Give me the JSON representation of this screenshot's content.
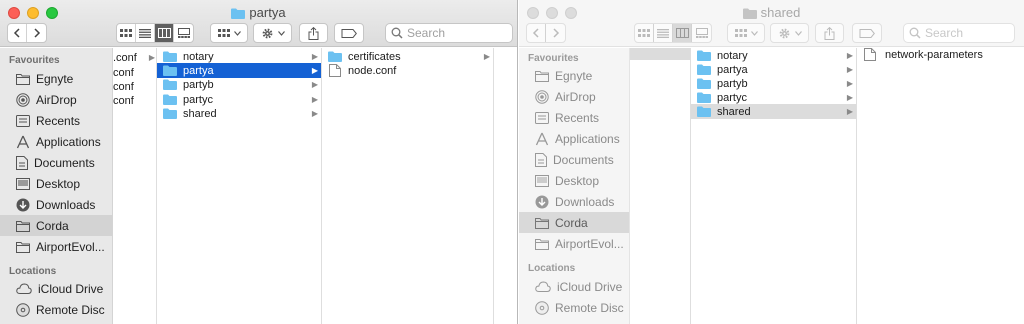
{
  "colors": {
    "close": "#fc5f57",
    "minimize": "#fdbc2e",
    "zoom": "#28c840",
    "inactive_light": "#dcdcdc",
    "selection": "#1461d4",
    "folder": "#6cc1f1"
  },
  "window1": {
    "title": "partya",
    "search_placeholder": "Search",
    "sidebar": {
      "favourites_heading": "Favourites",
      "favourites": [
        {
          "label": "Egnyte",
          "icon": "folder-icon"
        },
        {
          "label": "AirDrop",
          "icon": "airdrop-icon"
        },
        {
          "label": "Recents",
          "icon": "recents-icon"
        },
        {
          "label": "Applications",
          "icon": "applications-icon"
        },
        {
          "label": "Documents",
          "icon": "documents-icon"
        },
        {
          "label": "Desktop",
          "icon": "desktop-icon"
        },
        {
          "label": "Downloads",
          "icon": "downloads-icon"
        },
        {
          "label": "Corda",
          "icon": "folder-icon"
        },
        {
          "label": "AirportEvol...",
          "icon": "folder-icon"
        }
      ],
      "locations_heading": "Locations",
      "locations": [
        {
          "label": "iCloud Drive",
          "icon": "cloud-icon"
        },
        {
          "label": "Remote Disc",
          "icon": "disc-icon"
        }
      ]
    },
    "partial_column": [
      ".conf",
      "conf",
      "conf",
      "conf"
    ],
    "column1": [
      "notary",
      "partya",
      "partyb",
      "partyc",
      "shared"
    ],
    "column1_selected": "partya",
    "column2": [
      {
        "label": "certificates",
        "type": "folder"
      },
      {
        "label": "node.conf",
        "type": "file"
      }
    ]
  },
  "window2": {
    "title": "shared",
    "search_placeholder": "Search",
    "sidebar": {
      "favourites_heading": "Favourites",
      "favourites": [
        {
          "label": "Egnyte",
          "icon": "folder-icon"
        },
        {
          "label": "AirDrop",
          "icon": "airdrop-icon"
        },
        {
          "label": "Recents",
          "icon": "recents-icon"
        },
        {
          "label": "Applications",
          "icon": "applications-icon"
        },
        {
          "label": "Documents",
          "icon": "documents-icon"
        },
        {
          "label": "Desktop",
          "icon": "desktop-icon"
        },
        {
          "label": "Downloads",
          "icon": "downloads-icon"
        },
        {
          "label": "Corda",
          "icon": "folder-icon"
        },
        {
          "label": "AirportEvol...",
          "icon": "folder-icon"
        }
      ],
      "locations_heading": "Locations",
      "locations": [
        {
          "label": "iCloud Drive",
          "icon": "cloud-icon"
        },
        {
          "label": "Remote Disc",
          "icon": "disc-icon"
        }
      ]
    },
    "column1": [
      "notary",
      "partya",
      "partyb",
      "partyc",
      "shared"
    ],
    "column1_selected": "shared",
    "column2": [
      {
        "label": "network-parameters",
        "type": "file"
      }
    ]
  }
}
